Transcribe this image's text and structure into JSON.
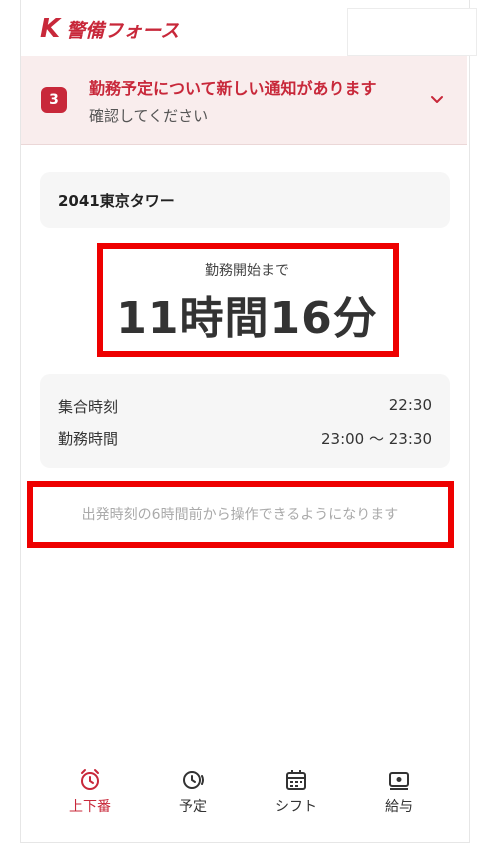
{
  "header": {
    "logo_mark": "K",
    "logo_text": "警備フォース"
  },
  "notice": {
    "count": "3",
    "title": "勤務予定について新しい通知があります",
    "subtitle": "確認してください"
  },
  "site": {
    "name": "2041東京タワー"
  },
  "countdown": {
    "label": "勤務開始まで",
    "value": "11時間16分"
  },
  "times": {
    "meeting_label": "集合時刻",
    "meeting_value": "22:30",
    "work_label": "勤務時間",
    "work_value": "23:00 〜 23:30"
  },
  "hint": "出発時刻の6時間前から操作できるようになります",
  "nav": {
    "items": [
      {
        "label": "上下番",
        "icon": "alarm-clock-icon",
        "active": true
      },
      {
        "label": "予定",
        "icon": "schedule-clock-icon",
        "active": false
      },
      {
        "label": "シフト",
        "icon": "calendar-icon",
        "active": false
      },
      {
        "label": "給与",
        "icon": "wallet-icon",
        "active": false
      }
    ]
  },
  "colors": {
    "brand": "#c8283a",
    "notice_bg": "#f9eded",
    "card_bg": "#f6f6f6",
    "highlight": "#ee0000"
  }
}
